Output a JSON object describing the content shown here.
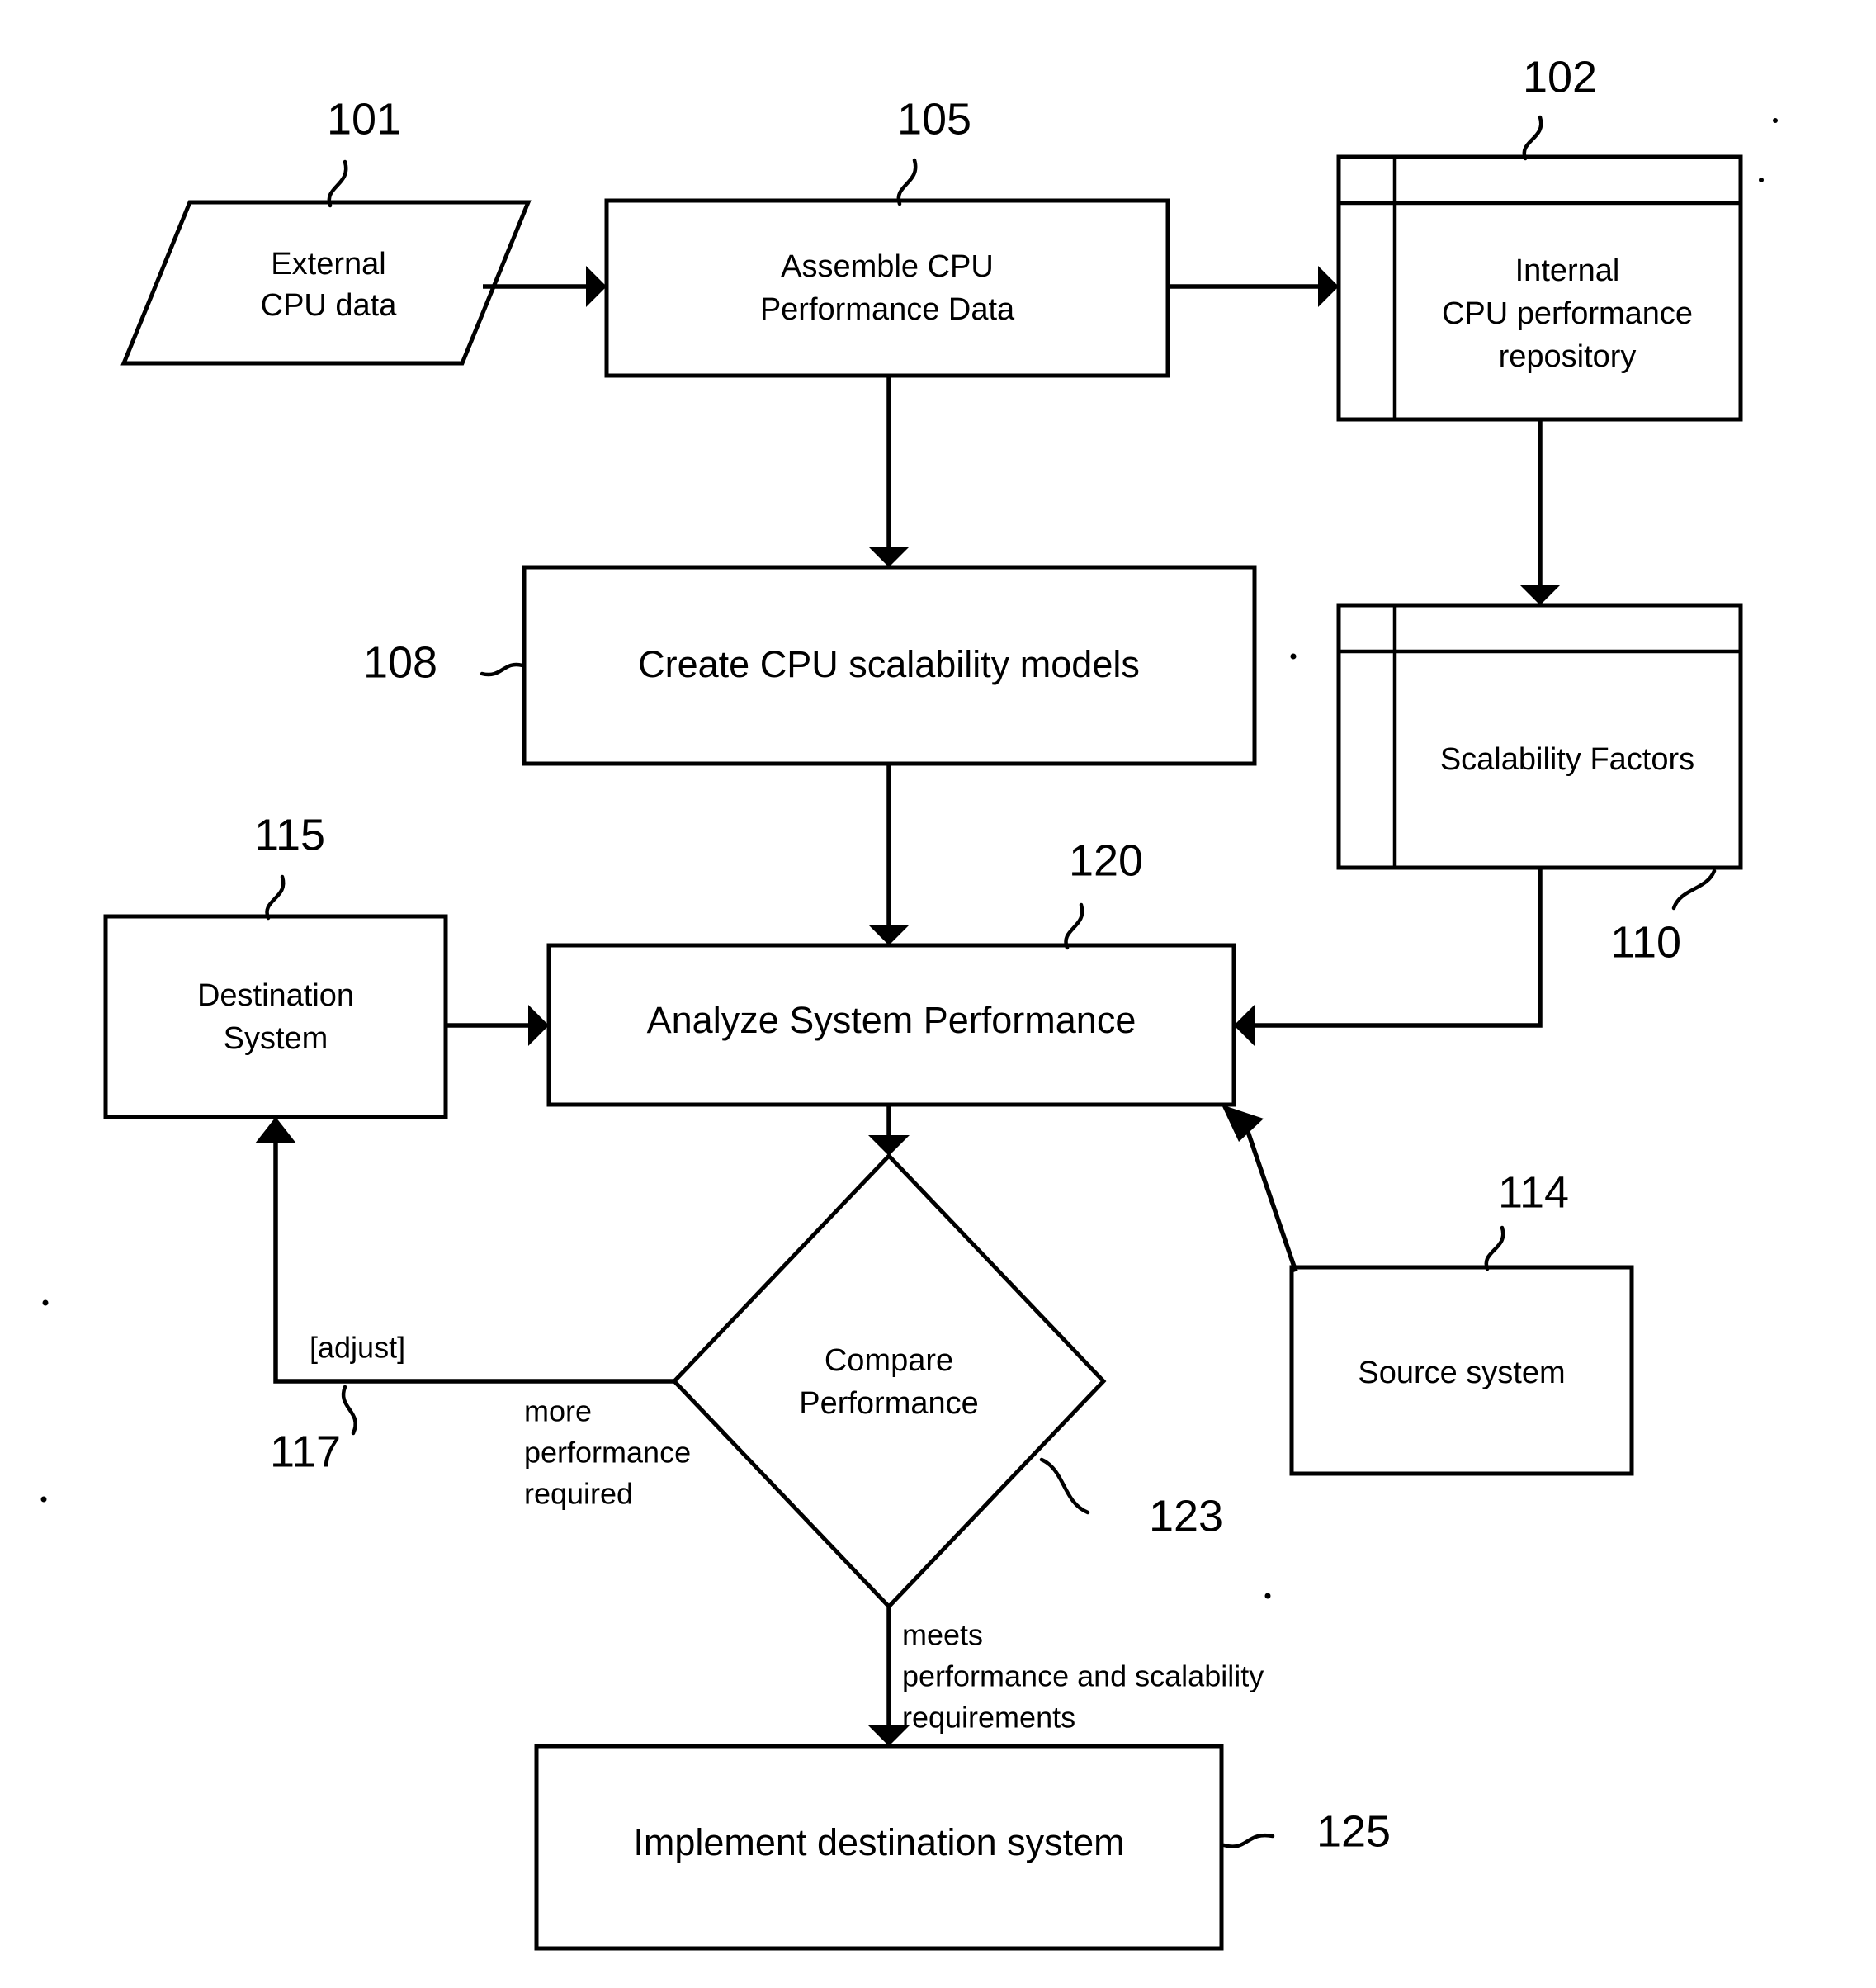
{
  "figure": {
    "title": "CPU performance and scalability analysis flowchart",
    "background_color": "#ffffff",
    "line_color": "#000000"
  },
  "nodes": {
    "external_cpu_data": {
      "label_line1": "External",
      "label_line2": "CPU data",
      "shape": "parallelogram",
      "ref": "101"
    },
    "assemble_cpu_performance_data": {
      "label_line1": "Assemble CPU",
      "label_line2": "Performance Data",
      "shape": "process-box",
      "ref": "105"
    },
    "internal_cpu_performance_repository": {
      "label_line1": "Internal",
      "label_line2": "CPU performance",
      "label_line3": "repository",
      "shape": "datastore-table",
      "ref": "102"
    },
    "create_cpu_scalability_models": {
      "label": "Create CPU scalability models",
      "shape": "process-box",
      "ref": "108"
    },
    "scalability_factors": {
      "label": "Scalability Factors",
      "shape": "datastore-table",
      "ref": "110"
    },
    "destination_system": {
      "label_line1": "Destination",
      "label_line2": "System",
      "shape": "process-box",
      "ref": "115"
    },
    "analyze_system_performance": {
      "label": "Analyze System Performance",
      "shape": "process-box",
      "ref": "120"
    },
    "source_system": {
      "label": "Source system",
      "shape": "process-box",
      "ref": "114"
    },
    "compare_performance": {
      "label_line1": "Compare",
      "label_line2": "Performance",
      "shape": "decision-diamond",
      "ref": "123"
    },
    "implement_destination_system": {
      "label": "Implement destination system",
      "shape": "process-box",
      "ref": "125"
    }
  },
  "edge_labels": {
    "adjust": "[adjust]",
    "adjust_ref": "117",
    "more_performance_required_line1": "more",
    "more_performance_required_line2": "performance",
    "more_performance_required_line3": "required",
    "meets_requirements_line1": "meets",
    "meets_requirements_line2": "performance and scalability",
    "meets_requirements_line3": "requirements"
  },
  "reference_numerals": {
    "n101": "101",
    "n102": "102",
    "n105": "105",
    "n108": "108",
    "n110": "110",
    "n114": "114",
    "n115": "115",
    "n117": "117",
    "n120": "120",
    "n123": "123",
    "n125": "125"
  }
}
